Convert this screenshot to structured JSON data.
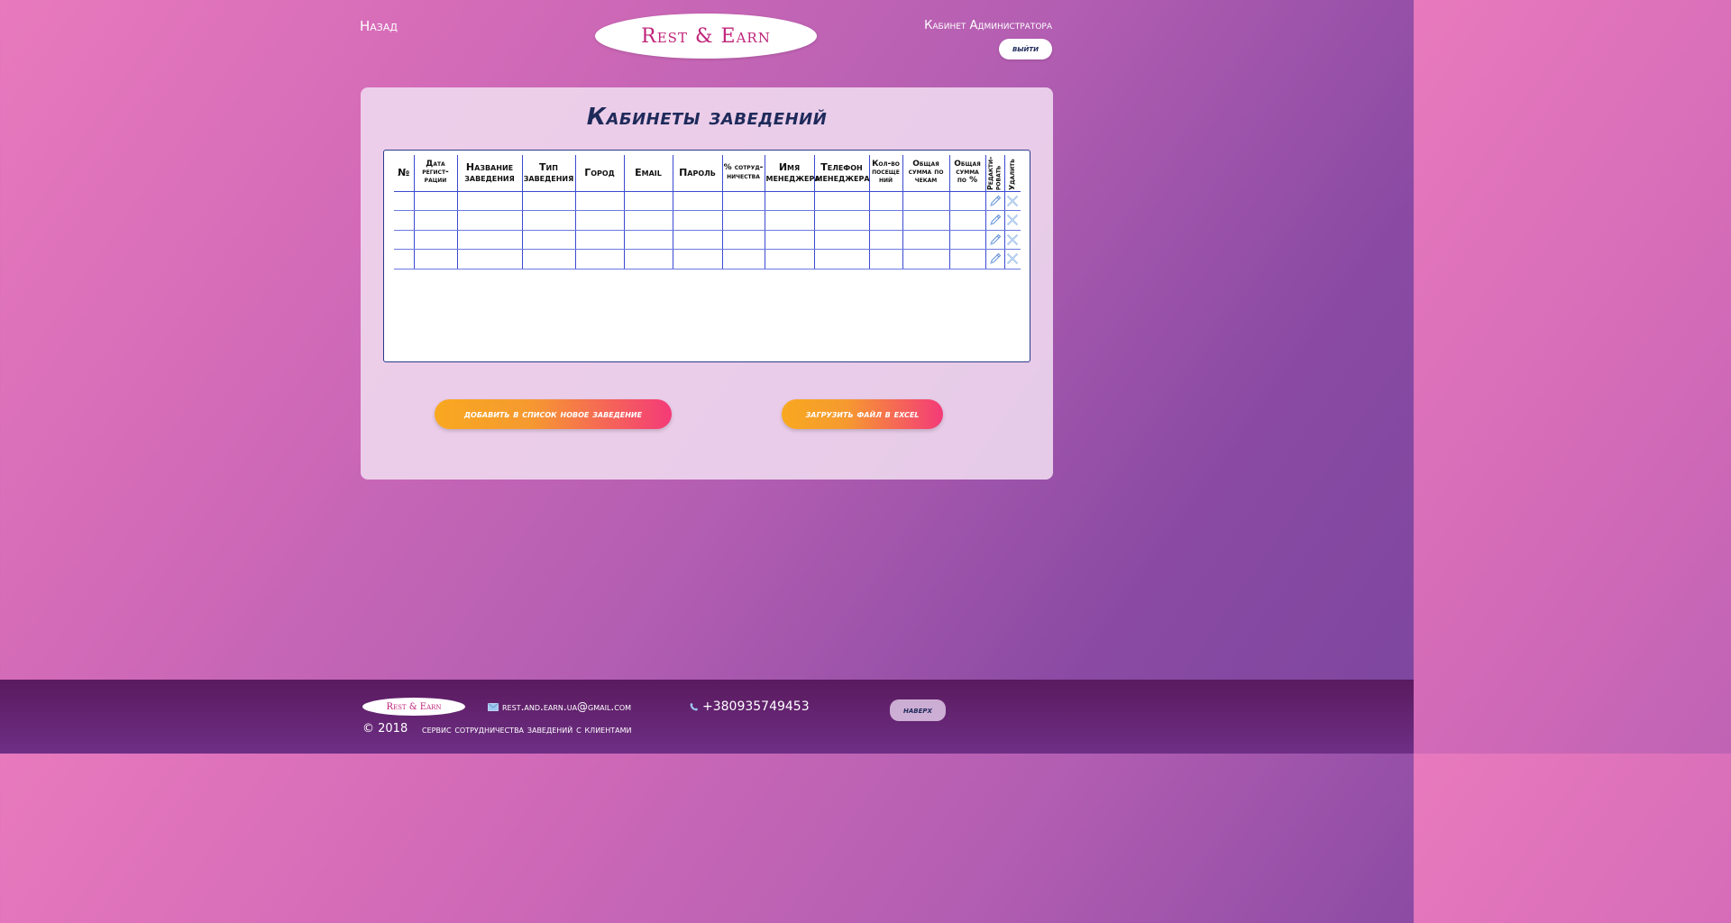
{
  "header": {
    "back_label": "Назад",
    "logo_text": "Rest & Earn",
    "admin_label": "Кабинет Администратора",
    "logout_label": "выйти"
  },
  "main": {
    "title": "Кабинеты заведений",
    "columns": [
      "№",
      "Дата регист-рации",
      "Название заведения",
      "Тип заведения",
      "Город",
      "Email",
      "Пароль",
      "% сотруд-ничества",
      "Имя менеджера",
      "Телефон менеджера",
      "Кол-во посеще ний",
      "Общая сумма по чекам",
      "Общая сумма по %",
      "Редакти-ровать",
      "Удалить"
    ],
    "rows": [
      [
        "",
        "",
        "",
        "",
        "",
        "",
        "",
        "",
        "",
        "",
        "",
        "",
        ""
      ],
      [
        "",
        "",
        "",
        "",
        "",
        "",
        "",
        "",
        "",
        "",
        "",
        "",
        ""
      ],
      [
        "",
        "",
        "",
        "",
        "",
        "",
        "",
        "",
        "",
        "",
        "",
        "",
        ""
      ],
      [
        "",
        "",
        "",
        "",
        "",
        "",
        "",
        "",
        "",
        "",
        "",
        "",
        ""
      ]
    ],
    "add_button_label": "добавить в список новое заведение",
    "excel_button_label": "загрузить файл в excel"
  },
  "footer": {
    "logo_text": "Rest & Earn",
    "email": "rest.and.earn.ua@gmail.com",
    "phone": "+380935749453",
    "up_label": "наверх",
    "copyright": "© 2018",
    "tagline": "сервис сотрудничества заведений с клиентами"
  },
  "colors": {
    "accent_dark": "#1e2a5a",
    "logo": "#c0247a",
    "table_lines": "#3a4ad0",
    "button_gradient_start": "#f8a820",
    "button_gradient_end": "#f43a78",
    "footer": "#5a1a5e"
  },
  "icons": {
    "edit": "pencil-icon",
    "delete": "cross-icon",
    "email": "envelope-icon",
    "phone": "phone-icon"
  }
}
